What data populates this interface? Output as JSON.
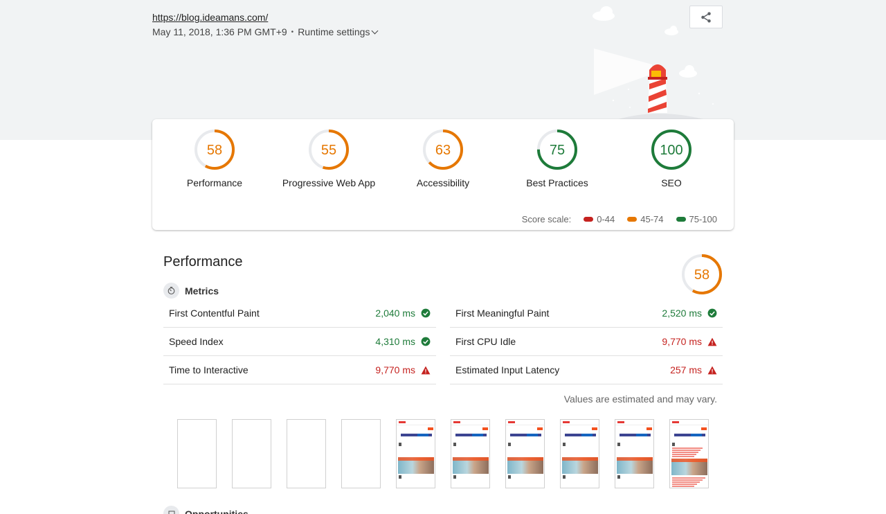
{
  "header": {
    "url": "https://blog.ideamans.com/",
    "timestamp": "May 11, 2018, 1:36 PM GMT+9",
    "separator": "•",
    "runtime_settings": "Runtime settings"
  },
  "icons": {
    "share": "share-icon",
    "metrics": "timer-icon",
    "pass": "check-circle-icon",
    "fail": "warning-triangle-icon",
    "opportunities": "opportunities-icon",
    "dropdown": "chevron-down-icon"
  },
  "colors": {
    "pass": "#1e7b3a",
    "average": "#e67700",
    "fail": "#c5221f",
    "track": "#e8eaed"
  },
  "scores": [
    {
      "label": "Performance",
      "value": "58",
      "score": 58,
      "color": "#e67700"
    },
    {
      "label": "Progressive Web App",
      "value": "55",
      "score": 55,
      "color": "#e67700"
    },
    {
      "label": "Accessibility",
      "value": "63",
      "score": 63,
      "color": "#e67700"
    },
    {
      "label": "Best Practices",
      "value": "75",
      "score": 75,
      "color": "#1e7b3a"
    },
    {
      "label": "SEO",
      "value": "100",
      "score": 100,
      "color": "#1e7b3a"
    }
  ],
  "scale": {
    "label": "Score scale:",
    "ranges": [
      {
        "text": "0-44",
        "color": "#c5221f"
      },
      {
        "text": "45-74",
        "color": "#e67700"
      },
      {
        "text": "75-100",
        "color": "#1e7b3a"
      }
    ]
  },
  "performance": {
    "title": "Performance",
    "score_text": "58",
    "score": 58,
    "metrics_title": "Metrics",
    "metrics": [
      {
        "label": "First Contentful Paint",
        "value": "2,040 ms",
        "status": "pass"
      },
      {
        "label": "First Meaningful Paint",
        "value": "2,520 ms",
        "status": "pass"
      },
      {
        "label": "Speed Index",
        "value": "4,310 ms",
        "status": "pass"
      },
      {
        "label": "First CPU Idle",
        "value": "9,770 ms",
        "status": "fail"
      },
      {
        "label": "Time to Interactive",
        "value": "9,770 ms",
        "status": "fail"
      },
      {
        "label": "Estimated Input Latency",
        "value": "257 ms",
        "status": "fail"
      }
    ],
    "note": "Values are estimated and may vary.",
    "filmstrip_frames": 10,
    "filmstrip_blank_frames": 4,
    "opportunities_title": "Opportunities"
  }
}
